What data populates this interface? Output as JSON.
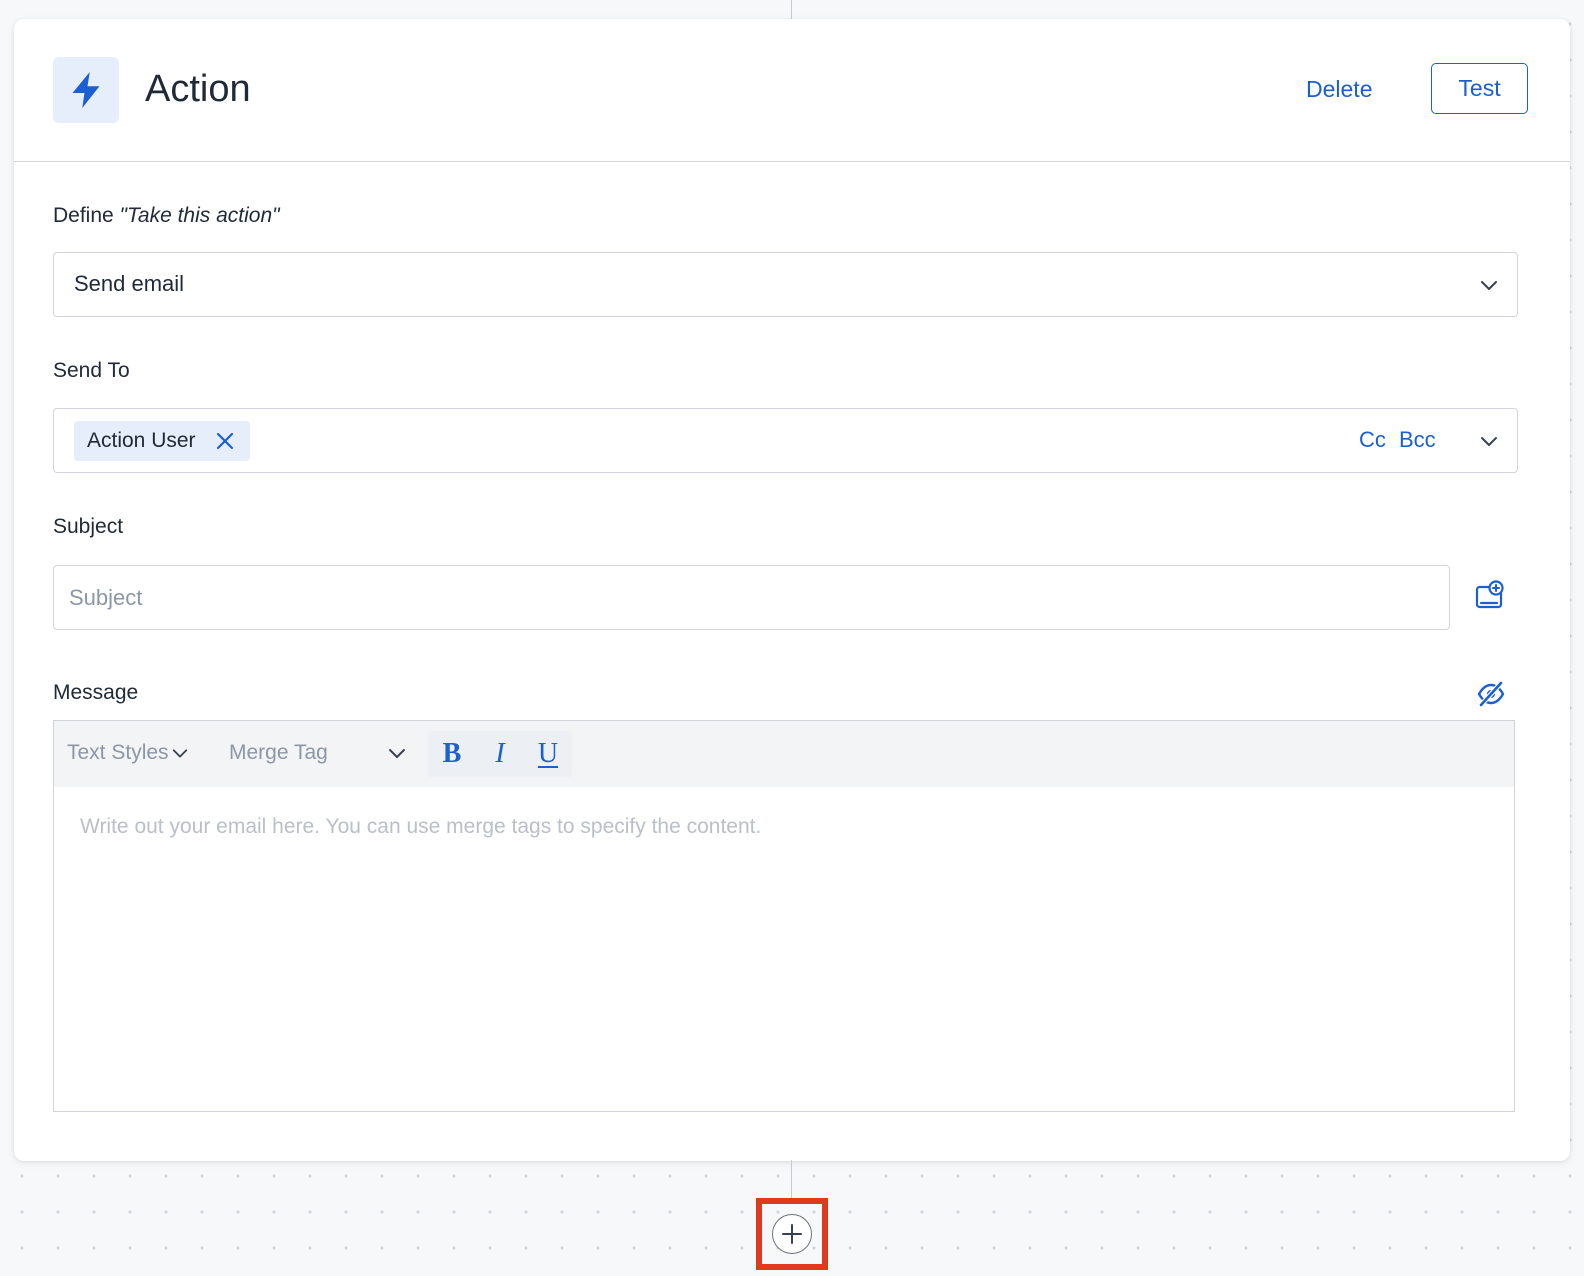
{
  "action_card": {
    "title": "Action",
    "icon": "lightning-icon",
    "delete_label": "Delete",
    "test_label": "Test"
  },
  "define_action": {
    "label_prefix": "Define ",
    "label_emphasis": "\"Take this action\"",
    "selected": "Send email"
  },
  "send_to": {
    "label": "Send To",
    "recipients": [
      "Action User"
    ],
    "cc_label": "Cc",
    "bcc_label": "Bcc"
  },
  "subject": {
    "label": "Subject",
    "value": "",
    "placeholder": "Subject"
  },
  "message": {
    "label": "Message",
    "toolbar": {
      "text_styles": "Text Styles",
      "merge_tag": "Merge Tag",
      "bold": "B",
      "italic": "I",
      "underline": "U"
    },
    "placeholder": "Write out your email here. You can use merge tags to specify the content."
  },
  "colors": {
    "accent": "#1b5fd1",
    "highlight": "#e03a1e"
  }
}
